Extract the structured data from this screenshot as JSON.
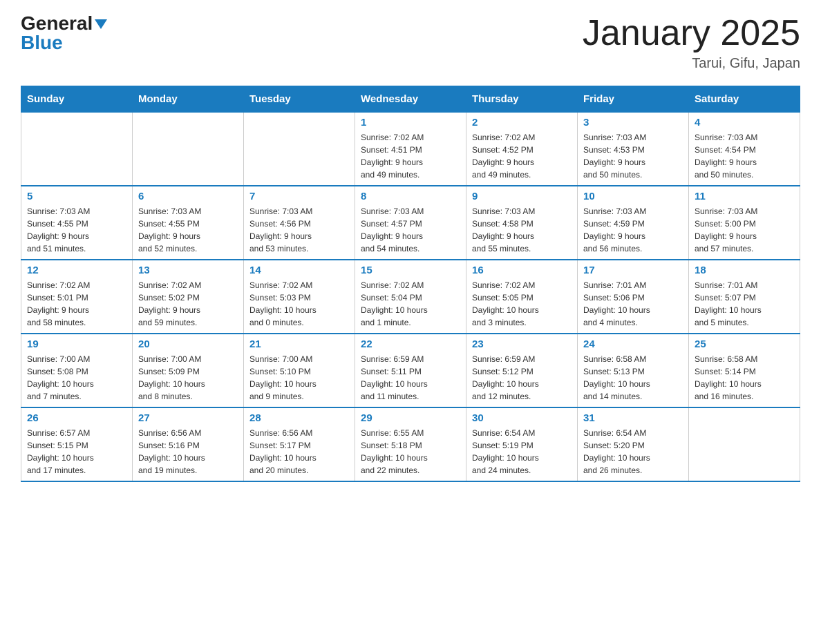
{
  "header": {
    "logo_general": "General",
    "logo_blue": "Blue",
    "month_title": "January 2025",
    "location": "Tarui, Gifu, Japan"
  },
  "weekdays": [
    "Sunday",
    "Monday",
    "Tuesday",
    "Wednesday",
    "Thursday",
    "Friday",
    "Saturday"
  ],
  "weeks": [
    [
      {
        "day": "",
        "info": ""
      },
      {
        "day": "",
        "info": ""
      },
      {
        "day": "",
        "info": ""
      },
      {
        "day": "1",
        "info": "Sunrise: 7:02 AM\nSunset: 4:51 PM\nDaylight: 9 hours\nand 49 minutes."
      },
      {
        "day": "2",
        "info": "Sunrise: 7:02 AM\nSunset: 4:52 PM\nDaylight: 9 hours\nand 49 minutes."
      },
      {
        "day": "3",
        "info": "Sunrise: 7:03 AM\nSunset: 4:53 PM\nDaylight: 9 hours\nand 50 minutes."
      },
      {
        "day": "4",
        "info": "Sunrise: 7:03 AM\nSunset: 4:54 PM\nDaylight: 9 hours\nand 50 minutes."
      }
    ],
    [
      {
        "day": "5",
        "info": "Sunrise: 7:03 AM\nSunset: 4:55 PM\nDaylight: 9 hours\nand 51 minutes."
      },
      {
        "day": "6",
        "info": "Sunrise: 7:03 AM\nSunset: 4:55 PM\nDaylight: 9 hours\nand 52 minutes."
      },
      {
        "day": "7",
        "info": "Sunrise: 7:03 AM\nSunset: 4:56 PM\nDaylight: 9 hours\nand 53 minutes."
      },
      {
        "day": "8",
        "info": "Sunrise: 7:03 AM\nSunset: 4:57 PM\nDaylight: 9 hours\nand 54 minutes."
      },
      {
        "day": "9",
        "info": "Sunrise: 7:03 AM\nSunset: 4:58 PM\nDaylight: 9 hours\nand 55 minutes."
      },
      {
        "day": "10",
        "info": "Sunrise: 7:03 AM\nSunset: 4:59 PM\nDaylight: 9 hours\nand 56 minutes."
      },
      {
        "day": "11",
        "info": "Sunrise: 7:03 AM\nSunset: 5:00 PM\nDaylight: 9 hours\nand 57 minutes."
      }
    ],
    [
      {
        "day": "12",
        "info": "Sunrise: 7:02 AM\nSunset: 5:01 PM\nDaylight: 9 hours\nand 58 minutes."
      },
      {
        "day": "13",
        "info": "Sunrise: 7:02 AM\nSunset: 5:02 PM\nDaylight: 9 hours\nand 59 minutes."
      },
      {
        "day": "14",
        "info": "Sunrise: 7:02 AM\nSunset: 5:03 PM\nDaylight: 10 hours\nand 0 minutes."
      },
      {
        "day": "15",
        "info": "Sunrise: 7:02 AM\nSunset: 5:04 PM\nDaylight: 10 hours\nand 1 minute."
      },
      {
        "day": "16",
        "info": "Sunrise: 7:02 AM\nSunset: 5:05 PM\nDaylight: 10 hours\nand 3 minutes."
      },
      {
        "day": "17",
        "info": "Sunrise: 7:01 AM\nSunset: 5:06 PM\nDaylight: 10 hours\nand 4 minutes."
      },
      {
        "day": "18",
        "info": "Sunrise: 7:01 AM\nSunset: 5:07 PM\nDaylight: 10 hours\nand 5 minutes."
      }
    ],
    [
      {
        "day": "19",
        "info": "Sunrise: 7:00 AM\nSunset: 5:08 PM\nDaylight: 10 hours\nand 7 minutes."
      },
      {
        "day": "20",
        "info": "Sunrise: 7:00 AM\nSunset: 5:09 PM\nDaylight: 10 hours\nand 8 minutes."
      },
      {
        "day": "21",
        "info": "Sunrise: 7:00 AM\nSunset: 5:10 PM\nDaylight: 10 hours\nand 9 minutes."
      },
      {
        "day": "22",
        "info": "Sunrise: 6:59 AM\nSunset: 5:11 PM\nDaylight: 10 hours\nand 11 minutes."
      },
      {
        "day": "23",
        "info": "Sunrise: 6:59 AM\nSunset: 5:12 PM\nDaylight: 10 hours\nand 12 minutes."
      },
      {
        "day": "24",
        "info": "Sunrise: 6:58 AM\nSunset: 5:13 PM\nDaylight: 10 hours\nand 14 minutes."
      },
      {
        "day": "25",
        "info": "Sunrise: 6:58 AM\nSunset: 5:14 PM\nDaylight: 10 hours\nand 16 minutes."
      }
    ],
    [
      {
        "day": "26",
        "info": "Sunrise: 6:57 AM\nSunset: 5:15 PM\nDaylight: 10 hours\nand 17 minutes."
      },
      {
        "day": "27",
        "info": "Sunrise: 6:56 AM\nSunset: 5:16 PM\nDaylight: 10 hours\nand 19 minutes."
      },
      {
        "day": "28",
        "info": "Sunrise: 6:56 AM\nSunset: 5:17 PM\nDaylight: 10 hours\nand 20 minutes."
      },
      {
        "day": "29",
        "info": "Sunrise: 6:55 AM\nSunset: 5:18 PM\nDaylight: 10 hours\nand 22 minutes."
      },
      {
        "day": "30",
        "info": "Sunrise: 6:54 AM\nSunset: 5:19 PM\nDaylight: 10 hours\nand 24 minutes."
      },
      {
        "day": "31",
        "info": "Sunrise: 6:54 AM\nSunset: 5:20 PM\nDaylight: 10 hours\nand 26 minutes."
      },
      {
        "day": "",
        "info": ""
      }
    ]
  ]
}
